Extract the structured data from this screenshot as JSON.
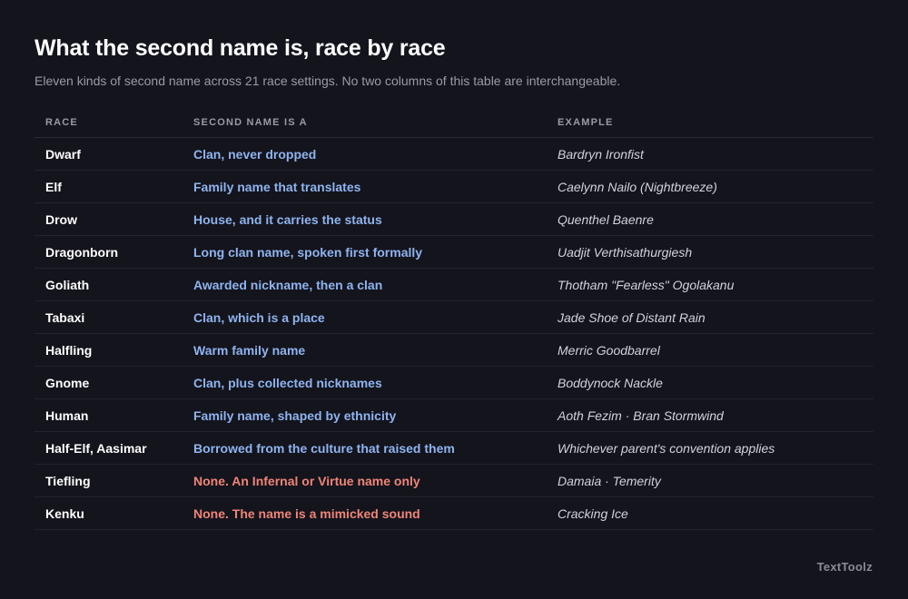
{
  "title": "What the second name is, race by race",
  "subtitle": "Eleven kinds of second name across 21 race settings. No two columns of this table are interchangeable.",
  "columns": {
    "race": "RACE",
    "second_name": "SECOND NAME IS A",
    "example": "EXAMPLE"
  },
  "rows": [
    {
      "race": "Dwarf",
      "kind": "Clan, never dropped",
      "example": "Bardryn Ironfist",
      "none": false
    },
    {
      "race": "Elf",
      "kind": "Family name that translates",
      "example": "Caelynn Nailo (Nightbreeze)",
      "none": false
    },
    {
      "race": "Drow",
      "kind": "House, and it carries the status",
      "example": "Quenthel Baenre",
      "none": false
    },
    {
      "race": "Dragonborn",
      "kind": "Long clan name, spoken first formally",
      "example": "Uadjit Verthisathurgiesh",
      "none": false
    },
    {
      "race": "Goliath",
      "kind": "Awarded nickname, then a clan",
      "example": "Thotham \"Fearless\" Ogolakanu",
      "none": false
    },
    {
      "race": "Tabaxi",
      "kind": "Clan, which is a place",
      "example": "Jade Shoe of Distant Rain",
      "none": false
    },
    {
      "race": "Halfling",
      "kind": "Warm family name",
      "example": "Merric Goodbarrel",
      "none": false
    },
    {
      "race": "Gnome",
      "kind": "Clan, plus collected nicknames",
      "example": "Boddynock Nackle",
      "none": false
    },
    {
      "race": "Human",
      "kind": "Family name, shaped by ethnicity",
      "example": "Aoth Fezim · Bran Stormwind",
      "none": false
    },
    {
      "race": "Half-Elf, Aasimar",
      "kind": "Borrowed from the culture that raised them",
      "example": "Whichever parent's convention applies",
      "none": false
    },
    {
      "race": "Tiefling",
      "kind": "None. An Infernal or Virtue name only",
      "example": "Damaia · Temerity",
      "none": true
    },
    {
      "race": "Kenku",
      "kind": "None. The name is a mimicked sound",
      "example": "Cracking Ice",
      "none": true
    }
  ],
  "brand": "TextToolz",
  "colors": {
    "background": "#14141d",
    "kind_accent": "#8eb4ee",
    "none_accent": "#ef8577"
  }
}
